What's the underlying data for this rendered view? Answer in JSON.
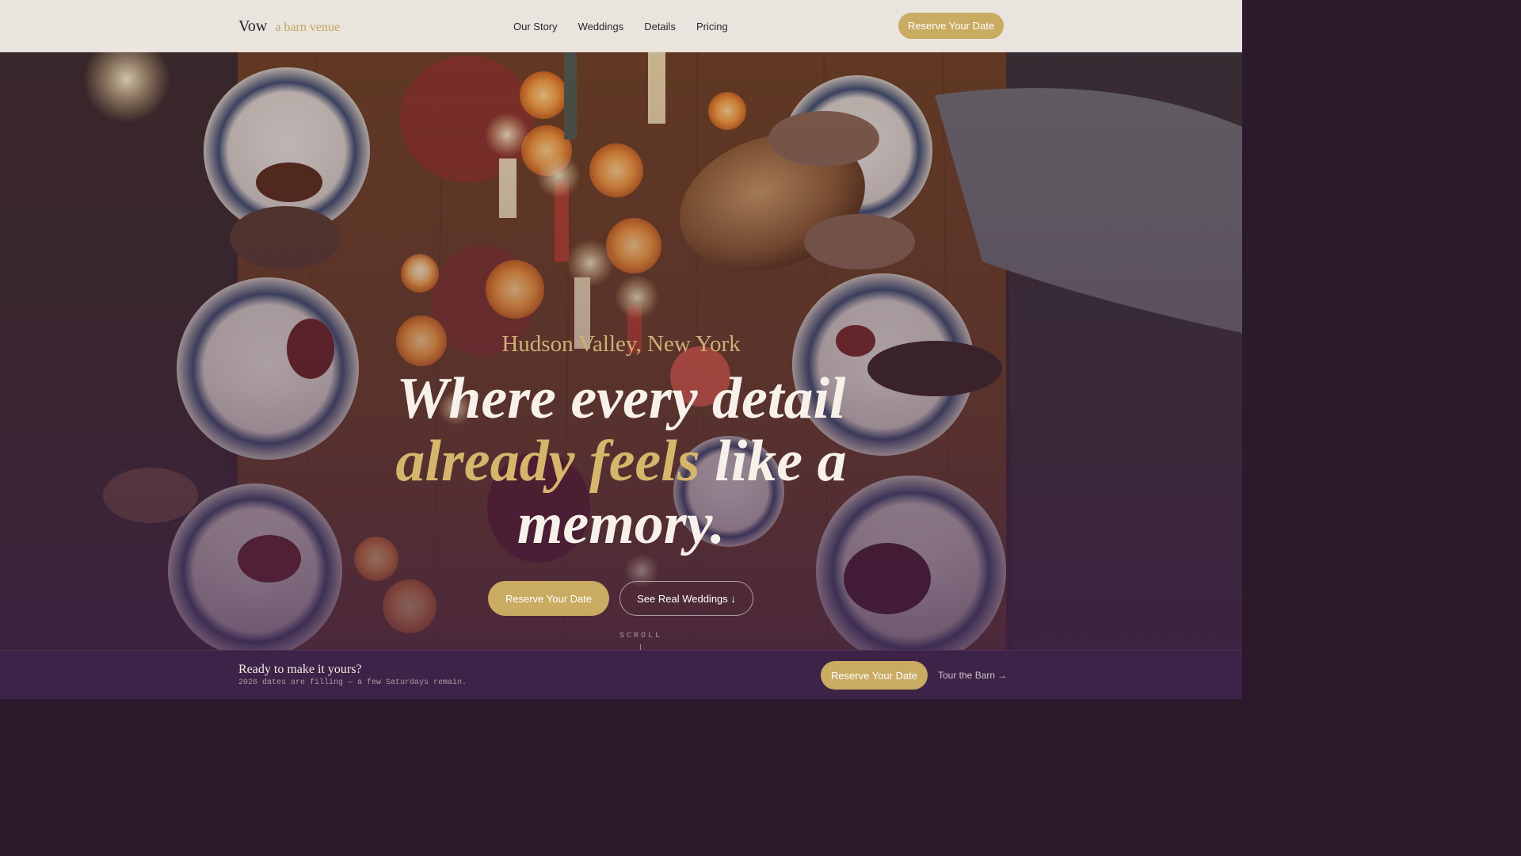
{
  "nav": {
    "brand_name": "Vow",
    "brand_tagline": "a barn venue",
    "links": [
      "Our Story",
      "Weddings",
      "Details",
      "Pricing"
    ],
    "cta_label": "Reserve Your Date"
  },
  "hero": {
    "eyebrow": "Hudson Valley, New York",
    "headline_line1": "Where every detail",
    "headline_gold": "already feels",
    "headline_line2_rest": "like a",
    "headline_line3": "memory.",
    "primary_cta": "Reserve Your Date",
    "secondary_cta": "See Real Weddings ↓",
    "scroll_label": "SCROLL"
  },
  "bottom_bar": {
    "title": "Ready to make it yours?",
    "subtitle": "2026 dates are filling — a few Saturdays remain.",
    "cta_label": "Reserve Your Date",
    "link_label": "Tour the Barn →"
  },
  "colors": {
    "accent_gold": "#c9ab62",
    "headline_gold": "#d6b56c",
    "bar_purple": "#3d2347",
    "nav_bg": "#f4f0ea"
  }
}
